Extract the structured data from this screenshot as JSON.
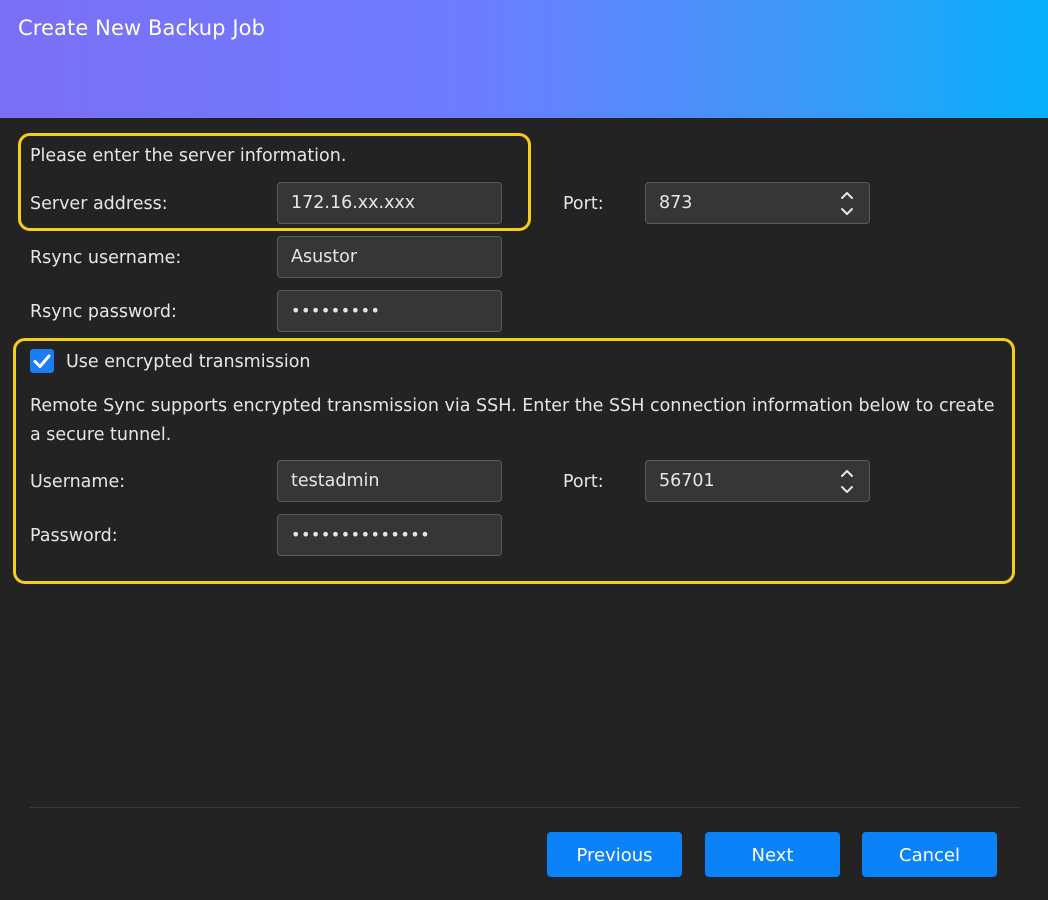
{
  "window": {
    "title": "Create New Backup Job"
  },
  "server": {
    "intro": "Please enter the server information.",
    "address_label": "Server address:",
    "address_value": "172.16.xx.xxx",
    "port_label": "Port:",
    "port_value": "873",
    "username_label": "Rsync username:",
    "username_value": "Asustor",
    "password_label": "Rsync password:",
    "password_value": "•••••••••"
  },
  "ssh": {
    "checkbox_label": "Use encrypted transmission",
    "checked": true,
    "description": "Remote Sync supports encrypted transmission via SSH. Enter the SSH connection information below to create a secure tunnel.",
    "username_label": "Username:",
    "username_value": "testadmin",
    "port_label": "Port:",
    "port_value": "56701",
    "password_label": "Password:",
    "password_value": "••••••••••••••"
  },
  "footer": {
    "previous_label": "Previous",
    "next_label": "Next",
    "cancel_label": "Cancel"
  },
  "colors": {
    "accent": "#0b82f7",
    "highlight": "#f6cd1a",
    "background": "#232323"
  }
}
